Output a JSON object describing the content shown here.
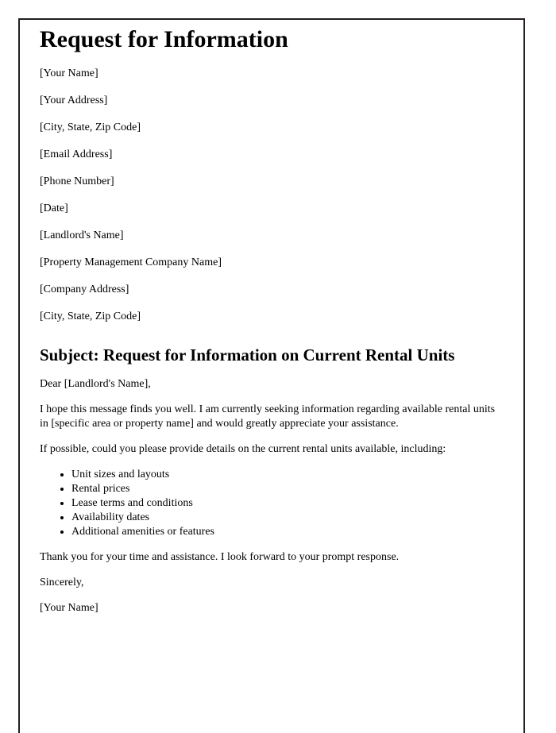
{
  "document": {
    "title": "Request for Information",
    "sender_block": [
      "[Your Name]",
      "[Your Address]",
      "[City, State, Zip Code]",
      "[Email Address]",
      "[Phone Number]"
    ],
    "date_line": "[Date]",
    "recipient_block": [
      "[Landlord's Name]",
      "[Property Management Company Name]",
      "[Company Address]",
      "[City, State, Zip Code]"
    ],
    "subject_heading": "Subject: Request for Information on Current Rental Units",
    "salutation": "Dear [Landlord's Name],",
    "paragraphs": [
      "I hope this message finds you well. I am currently seeking information regarding available rental units in [specific area or property name] and would greatly appreciate your assistance.",
      "If possible, could you please provide details on the current rental units available, including:"
    ],
    "detail_list": [
      "Unit sizes and layouts",
      "Rental prices",
      "Lease terms and conditions",
      "Availability dates",
      "Additional amenities or features"
    ],
    "closing_paragraph": "Thank you for your time and assistance. I look forward to your prompt response.",
    "closing_salutation": "Sincerely,",
    "signature_name": "[Your Name]"
  },
  "style": {
    "page_background": "#ffffff",
    "text_color": "#000000",
    "border_color": "#231f20"
  }
}
